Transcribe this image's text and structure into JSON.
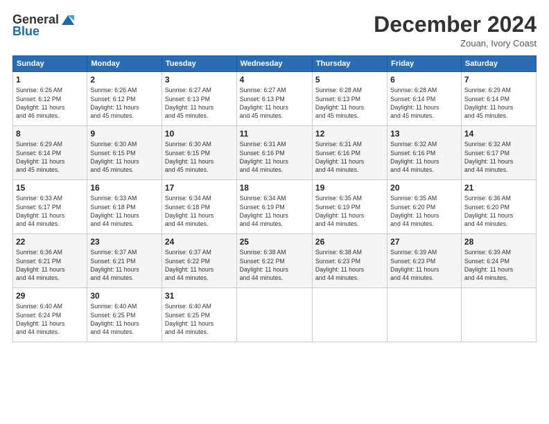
{
  "logo": {
    "general": "General",
    "blue": "Blue"
  },
  "header": {
    "title": "December 2024",
    "subtitle": "Zouan, Ivory Coast"
  },
  "days_of_week": [
    "Sunday",
    "Monday",
    "Tuesday",
    "Wednesday",
    "Thursday",
    "Friday",
    "Saturday"
  ],
  "weeks": [
    [
      {
        "day": "1",
        "info": "Sunrise: 6:26 AM\nSunset: 6:12 PM\nDaylight: 11 hours\nand 46 minutes."
      },
      {
        "day": "2",
        "info": "Sunrise: 6:26 AM\nSunset: 6:12 PM\nDaylight: 11 hours\nand 45 minutes."
      },
      {
        "day": "3",
        "info": "Sunrise: 6:27 AM\nSunset: 6:13 PM\nDaylight: 11 hours\nand 45 minutes."
      },
      {
        "day": "4",
        "info": "Sunrise: 6:27 AM\nSunset: 6:13 PM\nDaylight: 11 hours\nand 45 minutes."
      },
      {
        "day": "5",
        "info": "Sunrise: 6:28 AM\nSunset: 6:13 PM\nDaylight: 11 hours\nand 45 minutes."
      },
      {
        "day": "6",
        "info": "Sunrise: 6:28 AM\nSunset: 6:14 PM\nDaylight: 11 hours\nand 45 minutes."
      },
      {
        "day": "7",
        "info": "Sunrise: 6:29 AM\nSunset: 6:14 PM\nDaylight: 11 hours\nand 45 minutes."
      }
    ],
    [
      {
        "day": "8",
        "info": "Sunrise: 6:29 AM\nSunset: 6:14 PM\nDaylight: 11 hours\nand 45 minutes."
      },
      {
        "day": "9",
        "info": "Sunrise: 6:30 AM\nSunset: 6:15 PM\nDaylight: 11 hours\nand 45 minutes."
      },
      {
        "day": "10",
        "info": "Sunrise: 6:30 AM\nSunset: 6:15 PM\nDaylight: 11 hours\nand 45 minutes."
      },
      {
        "day": "11",
        "info": "Sunrise: 6:31 AM\nSunset: 6:16 PM\nDaylight: 11 hours\nand 44 minutes."
      },
      {
        "day": "12",
        "info": "Sunrise: 6:31 AM\nSunset: 6:16 PM\nDaylight: 11 hours\nand 44 minutes."
      },
      {
        "day": "13",
        "info": "Sunrise: 6:32 AM\nSunset: 6:16 PM\nDaylight: 11 hours\nand 44 minutes."
      },
      {
        "day": "14",
        "info": "Sunrise: 6:32 AM\nSunset: 6:17 PM\nDaylight: 11 hours\nand 44 minutes."
      }
    ],
    [
      {
        "day": "15",
        "info": "Sunrise: 6:33 AM\nSunset: 6:17 PM\nDaylight: 11 hours\nand 44 minutes."
      },
      {
        "day": "16",
        "info": "Sunrise: 6:33 AM\nSunset: 6:18 PM\nDaylight: 11 hours\nand 44 minutes."
      },
      {
        "day": "17",
        "info": "Sunrise: 6:34 AM\nSunset: 6:18 PM\nDaylight: 11 hours\nand 44 minutes."
      },
      {
        "day": "18",
        "info": "Sunrise: 6:34 AM\nSunset: 6:19 PM\nDaylight: 11 hours\nand 44 minutes."
      },
      {
        "day": "19",
        "info": "Sunrise: 6:35 AM\nSunset: 6:19 PM\nDaylight: 11 hours\nand 44 minutes."
      },
      {
        "day": "20",
        "info": "Sunrise: 6:35 AM\nSunset: 6:20 PM\nDaylight: 11 hours\nand 44 minutes."
      },
      {
        "day": "21",
        "info": "Sunrise: 6:36 AM\nSunset: 6:20 PM\nDaylight: 11 hours\nand 44 minutes."
      }
    ],
    [
      {
        "day": "22",
        "info": "Sunrise: 6:36 AM\nSunset: 6:21 PM\nDaylight: 11 hours\nand 44 minutes."
      },
      {
        "day": "23",
        "info": "Sunrise: 6:37 AM\nSunset: 6:21 PM\nDaylight: 11 hours\nand 44 minutes."
      },
      {
        "day": "24",
        "info": "Sunrise: 6:37 AM\nSunset: 6:22 PM\nDaylight: 11 hours\nand 44 minutes."
      },
      {
        "day": "25",
        "info": "Sunrise: 6:38 AM\nSunset: 6:22 PM\nDaylight: 11 hours\nand 44 minutes."
      },
      {
        "day": "26",
        "info": "Sunrise: 6:38 AM\nSunset: 6:23 PM\nDaylight: 11 hours\nand 44 minutes."
      },
      {
        "day": "27",
        "info": "Sunrise: 6:39 AM\nSunset: 6:23 PM\nDaylight: 11 hours\nand 44 minutes."
      },
      {
        "day": "28",
        "info": "Sunrise: 6:39 AM\nSunset: 6:24 PM\nDaylight: 11 hours\nand 44 minutes."
      }
    ],
    [
      {
        "day": "29",
        "info": "Sunrise: 6:40 AM\nSunset: 6:24 PM\nDaylight: 11 hours\nand 44 minutes."
      },
      {
        "day": "30",
        "info": "Sunrise: 6:40 AM\nSunset: 6:25 PM\nDaylight: 11 hours\nand 44 minutes."
      },
      {
        "day": "31",
        "info": "Sunrise: 6:40 AM\nSunset: 6:25 PM\nDaylight: 11 hours\nand 44 minutes."
      },
      null,
      null,
      null,
      null
    ]
  ]
}
